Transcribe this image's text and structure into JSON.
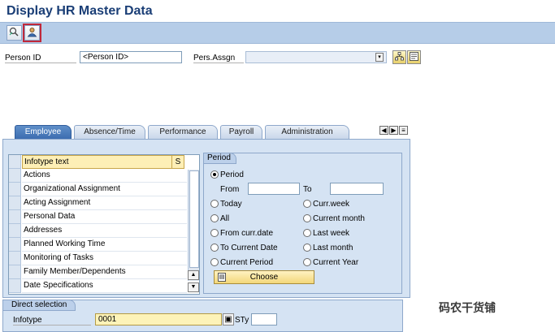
{
  "window": {
    "title": "Display HR Master Data"
  },
  "toolbar": {
    "buttons": [
      {
        "icon": "execute-search-icon"
      },
      {
        "icon": "person-icon",
        "selected": true
      }
    ]
  },
  "header": {
    "person_id_label": "Person ID",
    "person_id_placeholder": "<Person ID>",
    "pers_assgn_label": "Pers.Assgn"
  },
  "tabs": [
    "Employee",
    "Absence/Time",
    "Performance",
    "Payroll",
    "Administration"
  ],
  "infotype_table": {
    "col_text": "Infotype text",
    "col_s": "S",
    "rows": [
      "Actions",
      "Organizational Assignment",
      "Acting Assignment",
      "Personal Data",
      "Addresses",
      "Planned Working Time",
      "Monitoring of Tasks",
      "Family Member/Dependents",
      "Date Specifications"
    ]
  },
  "period": {
    "title": "Period",
    "period_label": "Period",
    "from_label": "From",
    "to_label": "To",
    "options_left": [
      "Today",
      "All",
      "From curr.date",
      "To Current Date",
      "Current Period"
    ],
    "options_right": [
      "Curr.week",
      "Current month",
      "Last week",
      "Last month",
      "Current Year"
    ],
    "choose_label": "Choose"
  },
  "direct_selection": {
    "title": "Direct selection",
    "infotype_label": "Infotype",
    "infotype_value": "0001",
    "sty_label": "STy"
  },
  "watermark": "码农干货铺"
}
